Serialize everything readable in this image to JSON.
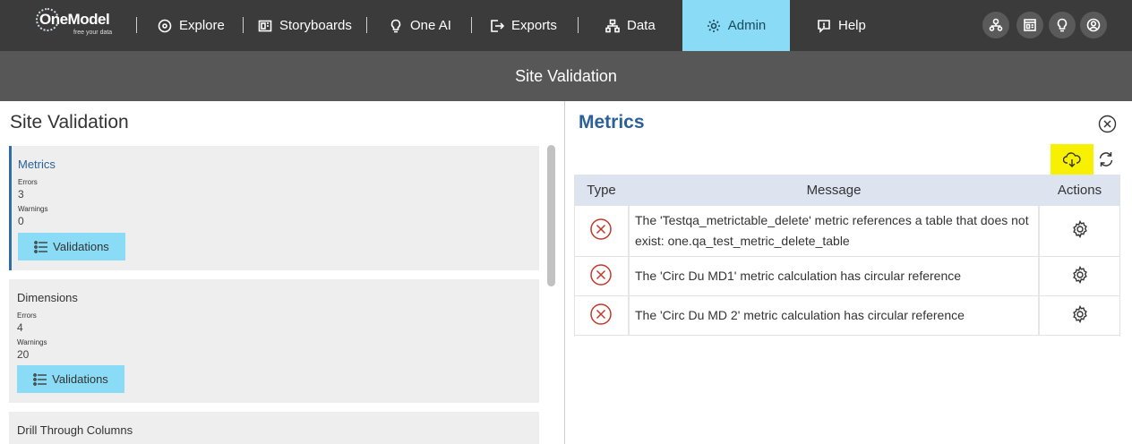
{
  "nav": {
    "logo_brand": "OneModel",
    "logo_tagline": "free your data",
    "items": [
      {
        "label": "Explore",
        "icon": "compass-icon"
      },
      {
        "label": "Storyboards",
        "icon": "storyboard-icon"
      },
      {
        "label": "One AI",
        "icon": "lightbulb-icon"
      },
      {
        "label": "Exports",
        "icon": "export-icon"
      },
      {
        "label": "Data",
        "icon": "hierarchy-icon"
      },
      {
        "label": "Admin",
        "icon": "gear-icon",
        "active": true
      },
      {
        "label": "Help",
        "icon": "help-chat-icon"
      }
    ],
    "right_icons": [
      "org-chart-icon",
      "dashboard-icon",
      "idea-icon",
      "user-icon"
    ],
    "active_color": "#8adbf5"
  },
  "page": {
    "header_title": "Site Validation"
  },
  "left": {
    "title": "Site Validation",
    "cards": [
      {
        "name": "Metrics",
        "errors_label": "Errors",
        "errors": "3",
        "warnings_label": "Warnings",
        "warnings": "0",
        "button": "Validations",
        "active": true
      },
      {
        "name": "Dimensions",
        "errors_label": "Errors",
        "errors": "4",
        "warnings_label": "Warnings",
        "warnings": "20",
        "button": "Validations"
      },
      {
        "name": "Drill Through Columns"
      }
    ]
  },
  "right": {
    "title": "Metrics",
    "table": {
      "headers": {
        "type": "Type",
        "message": "Message",
        "actions": "Actions"
      },
      "rows": [
        {
          "type": "error",
          "message": "The 'Testqa_metrictable_delete' metric references a table that does not exist: one.qa_test_metric_delete_table"
        },
        {
          "type": "error",
          "message": "The 'Circ Du MD1' metric calculation has circular reference"
        },
        {
          "type": "error",
          "message": "The 'Circ Du MD 2' metric calculation has circular reference"
        }
      ]
    },
    "highlight_color": "#f7f000",
    "error_color": "#c0392b"
  }
}
